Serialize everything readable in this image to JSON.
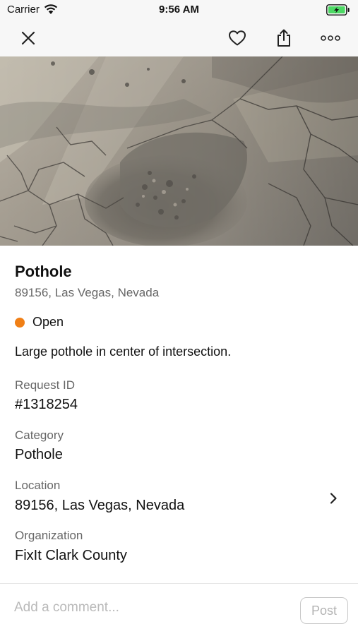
{
  "status_bar": {
    "carrier": "Carrier",
    "time": "9:56 AM",
    "icons": [
      "wifi-icon",
      "battery-charging-icon"
    ],
    "battery_color": "#4cd964"
  },
  "nav": {
    "icons": [
      "close-icon",
      "heart-icon",
      "share-icon",
      "more-icon"
    ]
  },
  "report": {
    "title": "Pothole",
    "address": "89156, Las Vegas, Nevada",
    "status": "Open",
    "status_color": "#f07f16",
    "description": "Large pothole in center of intersection.",
    "fields": [
      {
        "label": "Request ID",
        "value": "#1318254"
      },
      {
        "label": "Category",
        "value": "Pothole"
      },
      {
        "label": "Location",
        "value": "89156, Las Vegas, Nevada"
      },
      {
        "label": "Organization",
        "value": "FixIt Clark County"
      }
    ]
  },
  "comment": {
    "placeholder": "Add a comment...",
    "post_label": "Post"
  }
}
